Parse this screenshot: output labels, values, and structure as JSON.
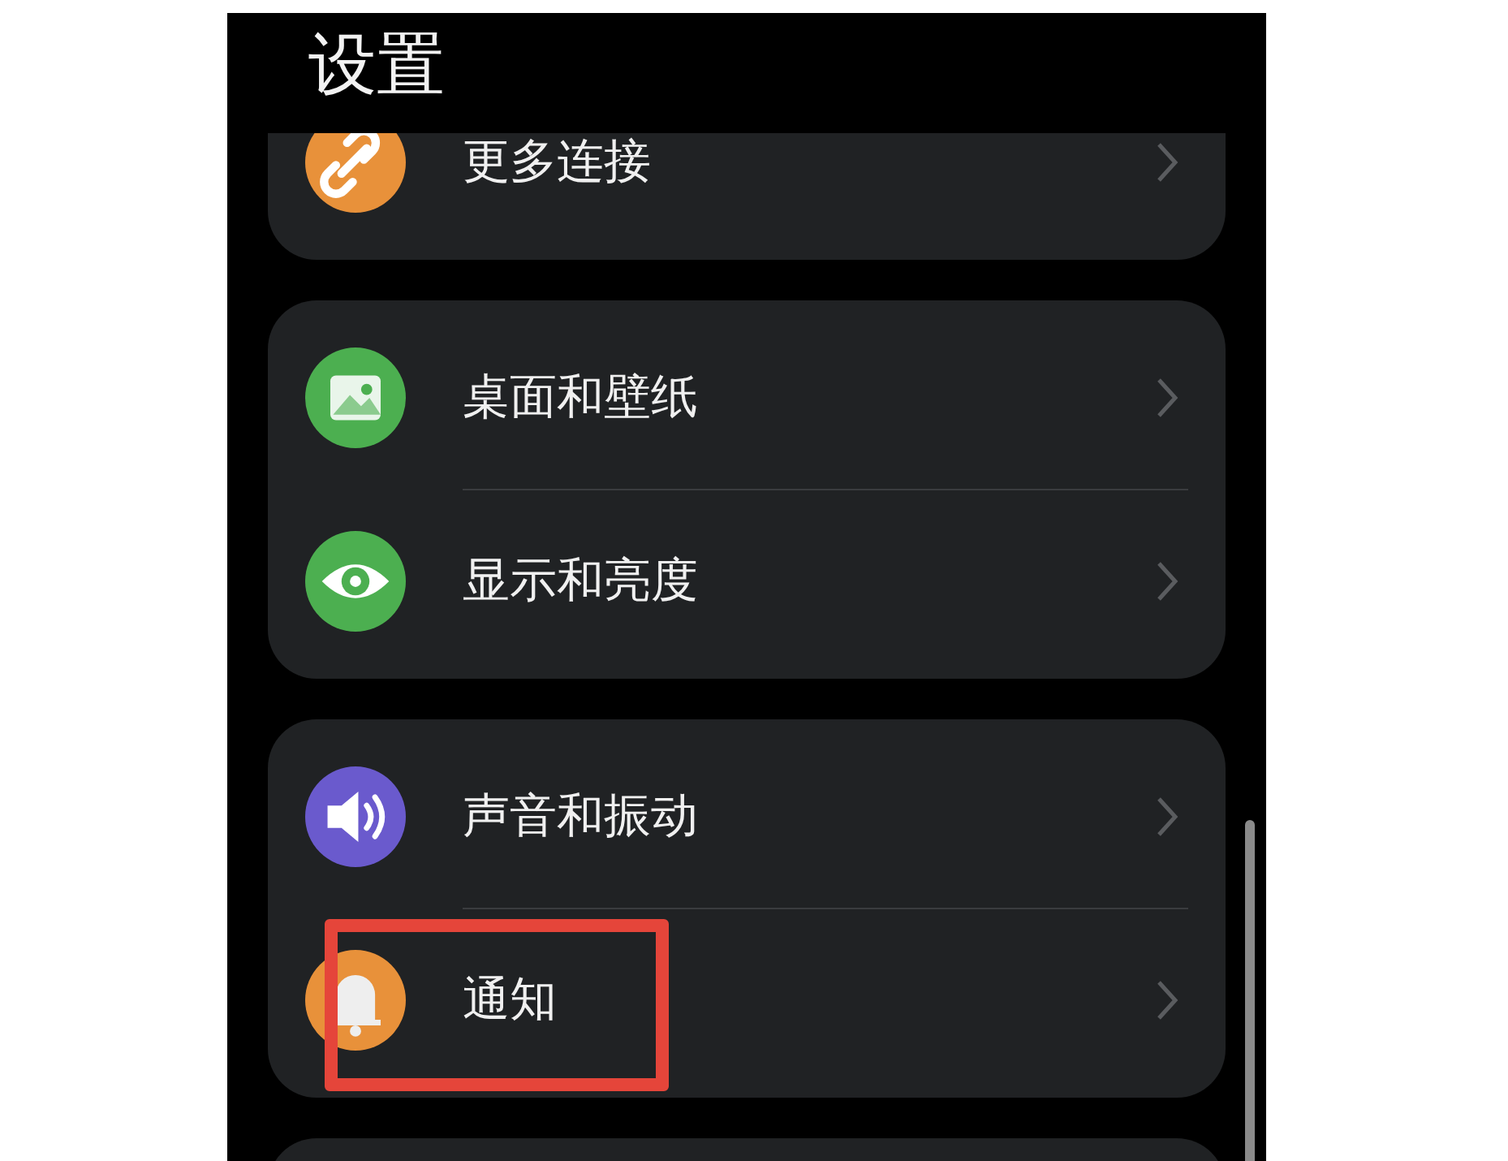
{
  "title": "设置",
  "groups": [
    {
      "items": [
        {
          "label": "更多连接",
          "highlighted": false
        }
      ]
    },
    {
      "items": [
        {
          "label": "桌面和壁纸",
          "highlighted": false
        },
        {
          "label": "显示和亮度",
          "highlighted": false
        }
      ]
    },
    {
      "items": [
        {
          "label": "声音和振动",
          "highlighted": false
        },
        {
          "label": "通知",
          "highlighted": true
        }
      ]
    }
  ]
}
